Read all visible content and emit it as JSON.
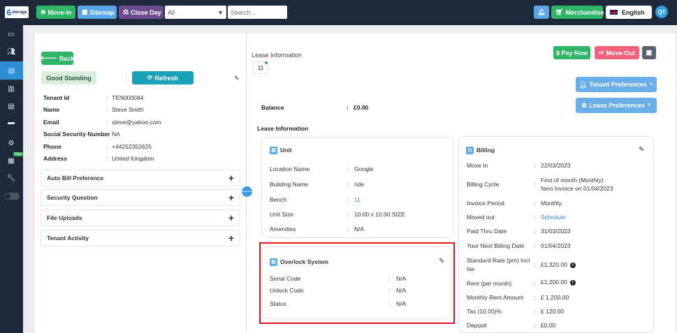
{
  "topbar": {
    "logo_big": "6",
    "logo_text": "storage",
    "move_in": "Move-In",
    "sitemap": "Sitemap",
    "close_day": "Close Day",
    "filter_value": "All",
    "search_placeholder": "Search...",
    "merchandise": "Merchandise",
    "language": "English",
    "user_initials": "QT",
    "colors": {
      "green": "#2fb567",
      "blue": "#5aa7e8",
      "purple": "#6c4c8f",
      "dark": "#1c2a3a"
    }
  },
  "sidebar": {
    "items": [
      "dashboard-icon",
      "users-icon",
      "units-icon",
      "building-icon",
      "document-icon",
      "truck-icon",
      "settings-icon",
      "calculator-icon",
      "wrench-icon"
    ],
    "new_badge": "New"
  },
  "left": {
    "back": "Back",
    "status": "Good Standing",
    "refresh": "Refresh",
    "fields": [
      {
        "label": "Tenant Id",
        "value": "TEN000084"
      },
      {
        "label": "Name",
        "value": "Steve Smith"
      },
      {
        "label": "Email",
        "value": "steve@yahoo.com"
      },
      {
        "label": "Social Security Number",
        "value": "NA"
      },
      {
        "label": "Phone",
        "value": "+44252352625"
      },
      {
        "label": "Address",
        "value": "United Kingdom"
      }
    ],
    "accordions": [
      "Auto Bill Preference",
      "Security Question",
      "File Uploads",
      "Tenant Activity"
    ]
  },
  "right": {
    "lease_info_title": "Lease Information",
    "lease_tab": "11",
    "pay_now": "$ Pay Now",
    "move_out": "Move-Out",
    "tenant_prefs": "Tenant Preferences",
    "lease_prefs": "Lease Preferences",
    "balance_label": "Balance",
    "balance_value": "£0.00",
    "lease_info_sub": "Lease Information",
    "unit": {
      "title": "Unit",
      "rows": [
        {
          "label": "Location Name",
          "value": "Google"
        },
        {
          "label": "Building Name",
          "value": "ride"
        },
        {
          "label": "Bench",
          "value": "11"
        },
        {
          "label": "Unit Size",
          "value": "10.00 x 10.00 SIZE"
        },
        {
          "label": "Amenities",
          "value": "N/A"
        }
      ]
    },
    "overlock": {
      "title": "Overlock System",
      "rows": [
        {
          "label": "Serial Code",
          "value": "N/A"
        },
        {
          "label": "Unlock Code",
          "value": "N/A"
        },
        {
          "label": "Status",
          "value": "N/A"
        }
      ]
    },
    "billing": {
      "title": "Billing",
      "rows": [
        {
          "label": "Move In",
          "value": "22/03/2023"
        },
        {
          "label": "Billing Cycle",
          "value": "First of month (Monthly)",
          "value2": "Next Invoice on 01/04/2023"
        },
        {
          "label": "Invoice Period",
          "value": "Monthly"
        },
        {
          "label": "Moved out",
          "value": "Schedule"
        },
        {
          "label": "Paid Thru Date",
          "value": "31/03/2023"
        },
        {
          "label": "Your Next Billing Date",
          "value": "01/04/2023"
        },
        {
          "label": "Standard Rate (pm) Incl",
          "label2": "tax",
          "value": "£1,320.00"
        },
        {
          "label": "Rent (per month)",
          "value": "£1,200.00"
        },
        {
          "label": "Monthly Rent Amount",
          "value": "£ 1,200.00"
        },
        {
          "label": "Tax (10.00)%",
          "value": "£ 120.00"
        },
        {
          "label": "Deposit",
          "value": "£0.00"
        }
      ]
    }
  }
}
